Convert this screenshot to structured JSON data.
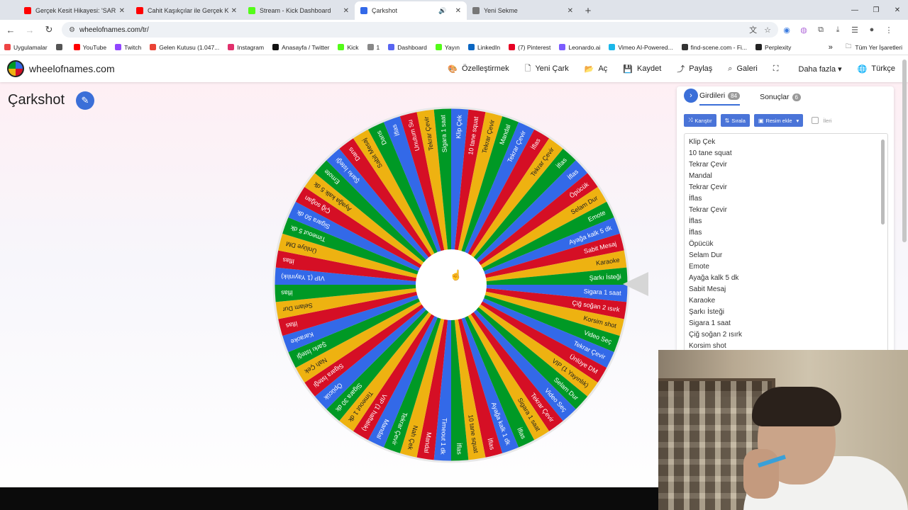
{
  "browser": {
    "tabs": [
      {
        "label": "Gerçek Kesit Hikayesi: 'SARI BM...",
        "icon_color": "#ff0000",
        "active": false
      },
      {
        "label": "Cahit Kaşıkçılar ile Gerçek Kesit",
        "icon_color": "#ff0000",
        "active": false
      },
      {
        "label": "Stream - Kick Dashboard",
        "icon_color": "#53fc18",
        "active": false
      },
      {
        "label": "Çarkshot",
        "icon_color": "#3369e8",
        "active": true
      },
      {
        "label": "Yeni Sekme",
        "icon_color": "#777777",
        "active": false
      }
    ],
    "new_tab": "+",
    "window_controls": [
      "—",
      "❐",
      "✕"
    ],
    "url": "wheelofnames.com/tr/",
    "bookmarks": [
      {
        "label": "Uygulamalar",
        "color": "#e44"
      },
      {
        "label": "",
        "color": "#555"
      },
      {
        "label": "YouTube",
        "color": "#ff0000"
      },
      {
        "label": "Twitch",
        "color": "#9146ff"
      },
      {
        "label": "Gelen Kutusu (1.047...",
        "color": "#ea4335"
      },
      {
        "label": "Instagram",
        "color": "#e1306c"
      },
      {
        "label": "Anasayfa / Twitter",
        "color": "#111"
      },
      {
        "label": "Kick",
        "color": "#53fc18"
      },
      {
        "label": "1",
        "color": "#888"
      },
      {
        "label": "Dashboard",
        "color": "#5865f2"
      },
      {
        "label": "Yayın",
        "color": "#53fc18"
      },
      {
        "label": "LinkedIn",
        "color": "#0a66c2"
      },
      {
        "label": "(7) Pinterest",
        "color": "#e60023"
      },
      {
        "label": "Leonardo.ai",
        "color": "#7b5cff"
      },
      {
        "label": "Vimeo AI-Powered...",
        "color": "#1ab7ea"
      },
      {
        "label": "find-scene.com - Fi...",
        "color": "#333"
      },
      {
        "label": "Perplexity",
        "color": "#222"
      }
    ],
    "bookmarks_overflow": "»",
    "all_bookmarks": "Tüm Yer İşaretleri"
  },
  "site": {
    "brand": "wheelofnames.com",
    "nav": [
      {
        "label": "Özelleştirmek",
        "icon": "palette-icon",
        "glyph": "🎨"
      },
      {
        "label": "Yeni Çark",
        "icon": "file-icon",
        "glyph": "🗋"
      },
      {
        "label": "Aç",
        "icon": "folder-icon",
        "glyph": "📂"
      },
      {
        "label": "Kaydet",
        "icon": "save-icon",
        "glyph": "💾"
      },
      {
        "label": "Paylaş",
        "icon": "share-icon",
        "glyph": "⤴"
      },
      {
        "label": "Galeri",
        "icon": "search-icon",
        "glyph": "⌕"
      },
      {
        "label": "",
        "icon": "fullscreen-icon",
        "glyph": "⛶"
      },
      {
        "label": "Daha fazla ▾",
        "icon": "",
        "glyph": ""
      },
      {
        "label": "Türkçe",
        "icon": "globe-icon",
        "glyph": "🌐"
      }
    ],
    "wheel_title": "Çarkshot"
  },
  "wheel": {
    "colors": [
      "#3369e8",
      "#d50f25",
      "#eeb211",
      "#009925"
    ],
    "segment_labels": [
      "Klip Çek",
      "10 tane squat",
      "Tekrar Çevir",
      "Mandal",
      "Tekrar Çevir",
      "İflas",
      "Tekrar Çevir",
      "İflas",
      "İflas",
      "Öpücük",
      "Selam Dur",
      "Emote",
      "Ayağa kalk 5 dk",
      "Sabit Mesaj",
      "Karaoke",
      "Şarkı İsteği",
      "Sigara 1 saat",
      "Çiğ soğan 2 ısırk",
      "Korsim shot",
      "Video Seç",
      "Tekrar Çevir",
      "Ünlüye DM",
      "VIP (1 Yayınlık)",
      "Selam Dur",
      "Video Seç",
      "Tekrar Çevir",
      "Sigara 1 saat",
      "İflas",
      "Ayağa kalk 1 dk",
      "İflas",
      "10 tane squat",
      "İflas",
      "Timeout 1 dk",
      "Mandal",
      "Nah Çek",
      "Tekrar Çevir",
      "Mandal",
      "VIP (1 haftalık)",
      "Timeout 1 dk",
      "Sigara 30 dk",
      "Öpücük",
      "Sigara İsteği",
      "Nah Çek",
      "Şarkı İsteği",
      "Karaoke",
      "İflas",
      "Selam Dur",
      "İflas",
      "VIP (1 Yayınlık)",
      "İflas",
      "Ünlüye DM",
      "Timeout 5 dk",
      "Sigara 50 dk",
      "Çiğ soğan",
      "Ayağa kalk 5 dk",
      "Emote",
      "Şarkı İsteği",
      "Dans",
      "Sabit Mesaj",
      "Dans",
      "İflas",
      "Unutum Su",
      "Tekrar Çevir",
      "Sigara 1 saat"
    ]
  },
  "panel": {
    "tab_entries": "Girdileri",
    "entries_count": "84",
    "tab_results": "Sonuçlar",
    "results_count": "6",
    "toolbar": {
      "shuffle": "Karıştır",
      "sort": "Sırala",
      "add_image": "Resim ekle",
      "advanced": "İleri"
    },
    "entries": [
      "Klip Çek",
      "10 tane squat",
      "Tekrar Çevir",
      "Mandal",
      "Tekrar Çevir",
      "İflas",
      "Tekrar Çevir",
      "İflas",
      "İflas",
      "Öpücük",
      "Selam Dur",
      "Emote",
      "Ayağa kalk 5 dk",
      "Sabit Mesaj",
      "Karaoke",
      "Şarkı İsteği",
      "Sigara 1 saat",
      "Çiğ soğan 2 ısırk",
      "Korsim shot"
    ]
  }
}
